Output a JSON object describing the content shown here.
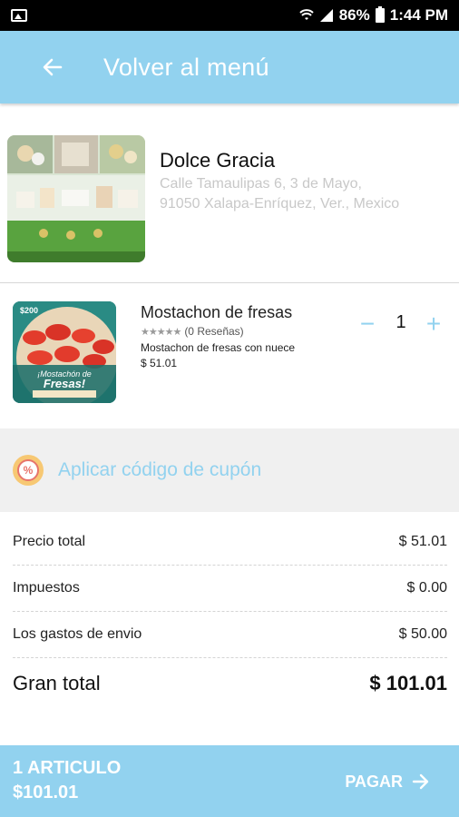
{
  "status_bar": {
    "battery": "86%",
    "time": "1:44 PM",
    "icons": [
      "image-icon",
      "wifi-icon",
      "signal-icon",
      "battery-icon"
    ]
  },
  "app_bar": {
    "title": "Volver al menú",
    "back_icon": "arrow-left-icon"
  },
  "store": {
    "name": "Dolce Gracia",
    "address_line1": "Calle Tamaulipas 6, 3 de Mayo,",
    "address_line2": "91050 Xalapa-Enríquez, Ver., Mexico"
  },
  "product": {
    "name": "Mostachon de fresas",
    "stars": "★★★★★",
    "reviews": "(0 Reseñas)",
    "description": "Mostachon de fresas con nuece",
    "price": "$ 51.01",
    "quantity": "1",
    "minus_label": "−",
    "plus_label": "+",
    "image_text": {
      "price_tag": "$200",
      "line1": "¡Mostachón de",
      "line2": "Fresas!"
    }
  },
  "coupon": {
    "label": "Aplicar código de cupón",
    "icon_text": "%"
  },
  "summary": {
    "rows": [
      {
        "label": "Precio total",
        "value": "$ 51.01"
      },
      {
        "label": "Impuestos",
        "value": "$ 0.00"
      },
      {
        "label": "Los gastos de envio",
        "value": "$ 50.00"
      }
    ],
    "grand_label": "Gran total",
    "grand_value": "$ 101.01"
  },
  "bottom_bar": {
    "items_count": "1 ARTICULO",
    "total": "$101.01",
    "pay_label": "PAGAR"
  },
  "colors": {
    "accent": "#92d2ef",
    "coupon_bg": "#f0f0f0",
    "coupon_icon": "#f7c873",
    "coupon_icon_ring": "#e7746b",
    "address": "#c8c8c8",
    "status_bar": "#000000"
  }
}
